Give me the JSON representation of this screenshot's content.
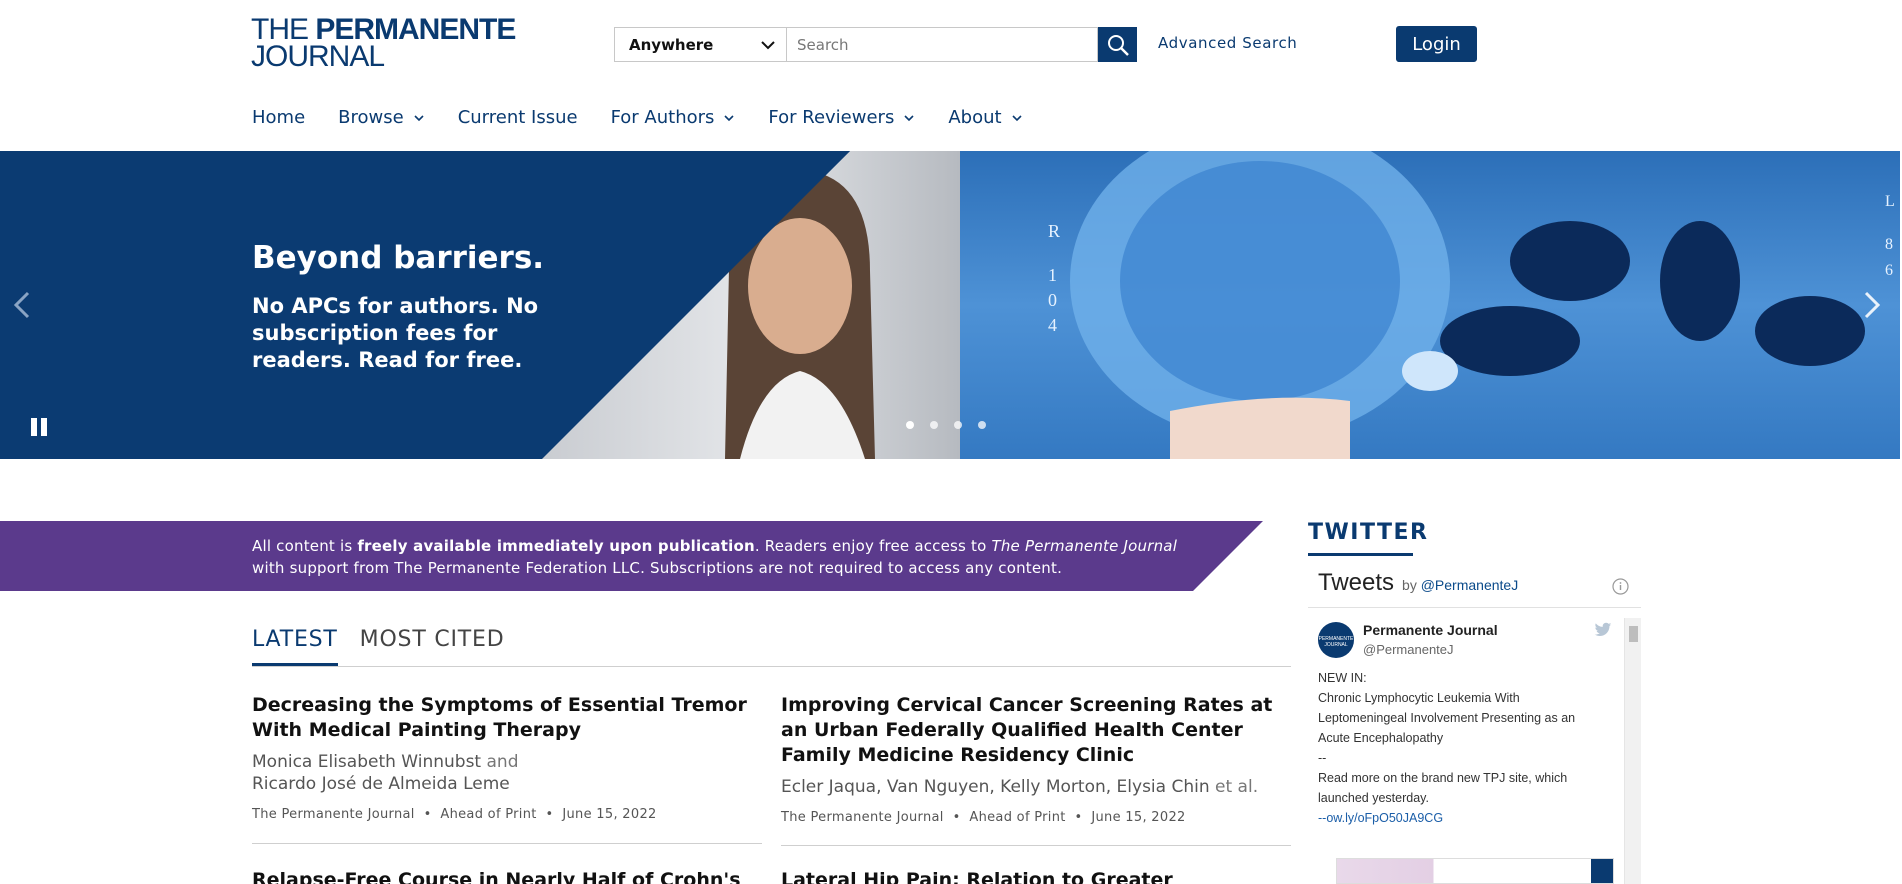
{
  "logo": {
    "line1_plain": "THE ",
    "line1_bold": "PERMANENTE",
    "line2": "JOURNAL"
  },
  "search": {
    "scope": "Anywhere",
    "placeholder": "Search",
    "advanced": "Advanced Search"
  },
  "login_label": "Login",
  "nav": [
    {
      "label": "Home",
      "dropdown": false
    },
    {
      "label": "Browse",
      "dropdown": true
    },
    {
      "label": "Current Issue",
      "dropdown": false
    },
    {
      "label": "For Authors",
      "dropdown": true
    },
    {
      "label": "For Reviewers",
      "dropdown": true
    },
    {
      "label": "About",
      "dropdown": true
    }
  ],
  "hero": {
    "heading": "Beyond barriers.",
    "text": "No APCs for authors. No subscription fees for readers. Read for free.",
    "slides": 4,
    "active_slide": 1
  },
  "banner": {
    "p1": "All content is ",
    "p2": "freely available immediately upon publication",
    "p3": ". Readers enjoy free access to ",
    "p4": "The Permanente Journal",
    "p5": "with support from The Permanente Federation LLC. Subscriptions are not required to access any content."
  },
  "tabs": {
    "latest": "LATEST",
    "cited": "MOST CITED"
  },
  "articles": [
    {
      "title": "Decreasing the Symptoms of Essential Tremor With Medical Painting Therapy",
      "author1": "Monica Elisabeth Winnubst",
      "conj": " and",
      "author2": "Ricardo José de Almeida Leme",
      "journal": "The Permanente Journal",
      "status": "Ahead of Print",
      "date": "June 15, 2022"
    },
    {
      "title": "Improving Cervical Cancer Screening Rates at an Urban Federally Qualified Health Center Family Medicine Residency Clinic",
      "authors": "Ecler Jaqua, Van Nguyen, Kelly Morton, Elysia Chin",
      "etal": " et al.",
      "journal": "The Permanente Journal",
      "status": "Ahead of Print",
      "date": "June 15, 2022"
    }
  ],
  "more_titles": [
    "Relapse-Free Course in Nearly Half of Crohn's",
    "Lateral Hip Pain: Relation to Greater Trochanteric"
  ],
  "twitter": {
    "heading": "TWITTER",
    "tweets": "Tweets",
    "by": "by",
    "handle_link": "@PermanenteJ",
    "name": "Permanente Journal",
    "handle": "@PermanenteJ",
    "avatar_text": "PERMANENTE JOURNAL",
    "l1": "NEW IN:",
    "l2": "Chronic Lymphocytic Leukemia With",
    "l3": "Leptomeningeal Involvement Presenting as an",
    "l4": "Acute Encephalopathy",
    "l5": "--",
    "l6": "Read more on the brand new TPJ site, which",
    "l7": "launched yesterday.",
    "l8": "--ow.ly/oFpO50JA9CG"
  }
}
